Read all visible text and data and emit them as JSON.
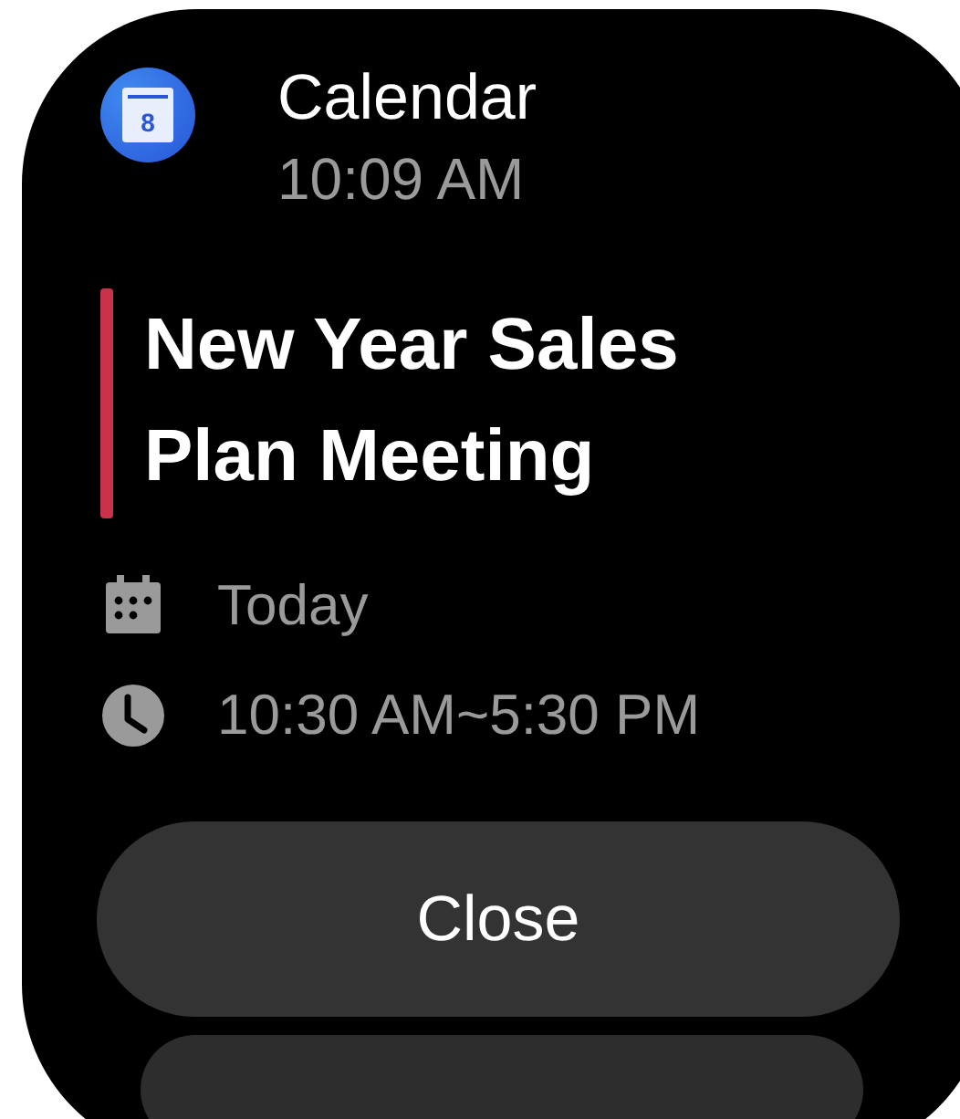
{
  "app": {
    "name": "Calendar",
    "time": "10:09 AM",
    "icon_day": "8"
  },
  "event": {
    "title": "New Year Sales Plan Meeting",
    "color": "#c8334a"
  },
  "details": [
    {
      "kind": "date",
      "text": "Today"
    },
    {
      "kind": "time",
      "text": "10:30 AM~5:30 PM"
    }
  ],
  "buttons": [
    "Close"
  ]
}
